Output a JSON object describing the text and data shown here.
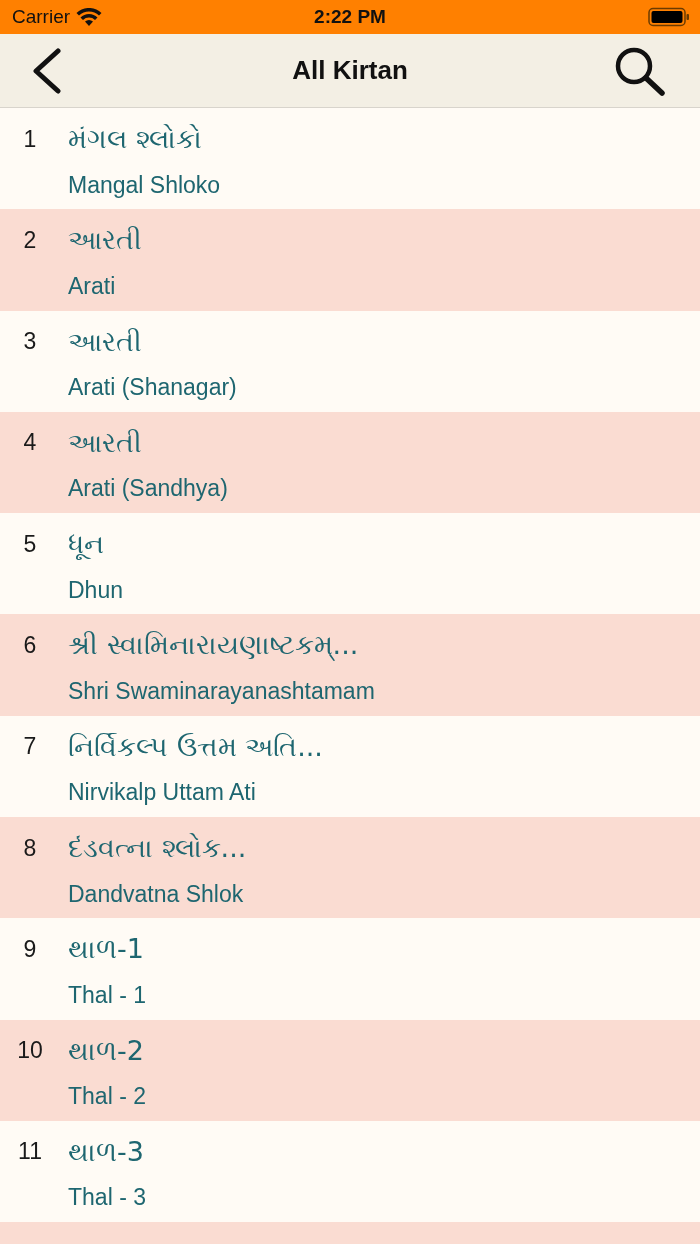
{
  "status_bar": {
    "carrier": "Carrier",
    "time": "2:22 PM"
  },
  "nav_bar": {
    "title": "All Kirtan"
  },
  "kirtans": [
    {
      "number": "1",
      "title": "મંગલ શ્લોકો",
      "subtitle": "Mangal Shloko"
    },
    {
      "number": "2",
      "title": "આરતી",
      "subtitle": "Arati"
    },
    {
      "number": "3",
      "title": "આરતી",
      "subtitle": "Arati (Shanagar)"
    },
    {
      "number": "4",
      "title": "આરતી",
      "subtitle": "Arati (Sandhya)"
    },
    {
      "number": "5",
      "title": "ધૂન",
      "subtitle": "Dhun"
    },
    {
      "number": "6",
      "title": "શ્રી સ્વામિનારાયણાષ્ટકમ્...",
      "subtitle": "Shri Swaminarayanashtamam"
    },
    {
      "number": "7",
      "title": "નિર્વિકલ્પ ઉત્તમ અતિ...",
      "subtitle": "Nirvikalp Uttam Ati"
    },
    {
      "number": "8",
      "title": "દંડવત્ના શ્લોક...",
      "subtitle": "Dandvatna Shlok"
    },
    {
      "number": "9",
      "title": "થાળ-1",
      "subtitle": "Thal - 1"
    },
    {
      "number": "10",
      "title": "થાળ-2",
      "subtitle": "Thal - 2"
    },
    {
      "number": "11",
      "title": "થાળ-3",
      "subtitle": "Thal - 3"
    }
  ]
}
